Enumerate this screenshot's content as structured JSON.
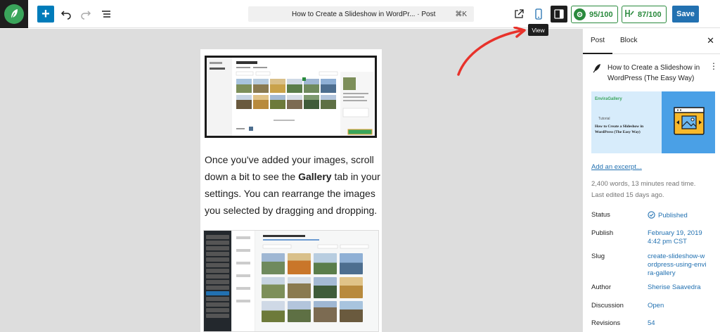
{
  "toolbar": {
    "add_label": "+",
    "document_title": "How to Create a Slideshow in WordPr... · Post",
    "shortcut": "⌘K",
    "score1": "95/100",
    "score2": "87/100",
    "save_label": "Save",
    "tooltip": "View"
  },
  "canvas": {
    "paragraph_before": "Once you've added your images, scroll down a bit to see the ",
    "paragraph_bold": "Gallery",
    "paragraph_after": " tab in your settings. You can rearrange the images you selected by dragging and dropping."
  },
  "sidebar": {
    "tabs": [
      "Post",
      "Block"
    ],
    "post_title": "How to Create a Slideshow in WordPress (The Easy Way)",
    "featured_image": {
      "brand": "EnviraGallery",
      "tag": "Tutorial",
      "headline": "How to Create a Slideshow in WordPress (The Easy Way)"
    },
    "excerpt_link": "Add an excerpt...",
    "word_count": "2,400 words, 13 minutes read time.",
    "last_edited": "Last edited 15 days ago.",
    "rows": [
      {
        "label": "Status",
        "value": "Published"
      },
      {
        "label": "Publish",
        "value": "February 19, 2019 4:42 pm CST"
      },
      {
        "label": "Slug",
        "value": "create-slideshow-wordpress-using-envira-gallery"
      },
      {
        "label": "Author",
        "value": "Sherise Saavedra"
      },
      {
        "label": "Discussion",
        "value": "Open"
      },
      {
        "label": "Revisions",
        "value": "54"
      }
    ]
  },
  "colors": {
    "accent": "#2271b1",
    "score_green": "#2a8a3d",
    "arrow_red": "#e8322b"
  }
}
